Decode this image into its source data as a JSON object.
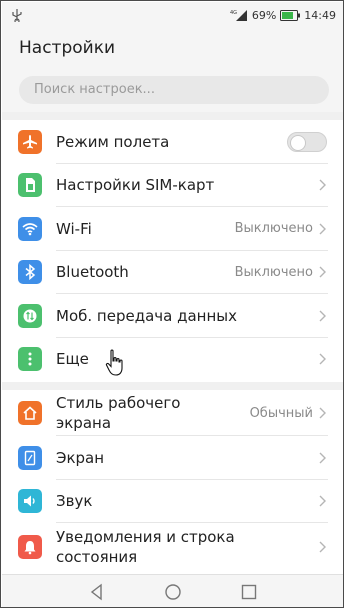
{
  "status": {
    "network": "4G",
    "battery": "69%",
    "time": "14:49"
  },
  "header": {
    "title": "Настройки"
  },
  "search": {
    "placeholder": "Поиск настроек..."
  },
  "group1": [
    {
      "label": "Режим полета",
      "icon": "airplane-icon",
      "color": "#f0722a",
      "control": "toggle"
    },
    {
      "label": "Настройки SIM-карт",
      "icon": "sim-card-icon",
      "color": "#4cc06e",
      "control": "chevron"
    },
    {
      "label": "Wi-Fi",
      "icon": "wifi-icon",
      "color": "#3f8fe8",
      "value": "Выключено",
      "control": "chevron"
    },
    {
      "label": "Bluetooth",
      "icon": "bluetooth-icon",
      "color": "#3f8fe8",
      "value": "Выключено",
      "control": "chevron"
    },
    {
      "label": "Моб. передача данных",
      "icon": "mobile-data-icon",
      "color": "#4cc06e",
      "control": "chevron"
    },
    {
      "label": "Еще",
      "icon": "more-icon",
      "color": "#4cc06e",
      "control": "chevron"
    }
  ],
  "group2": [
    {
      "label": "Стиль рабочего экрана",
      "line1": "Стиль рабочего",
      "line2": "экрана",
      "icon": "home-icon",
      "color": "#f0722a",
      "value": "Обычный",
      "control": "chevron"
    },
    {
      "label": "Экран",
      "icon": "display-icon",
      "color": "#3f8fe8",
      "control": "chevron"
    },
    {
      "label": "Звук",
      "icon": "sound-icon",
      "color": "#2fb6d6",
      "control": "chevron"
    },
    {
      "label": "Уведомления и строка состояния",
      "line1": "Уведомления и строка",
      "line2": "состояния",
      "icon": "notification-icon",
      "color": "#f05a4a",
      "control": "chevron"
    }
  ]
}
